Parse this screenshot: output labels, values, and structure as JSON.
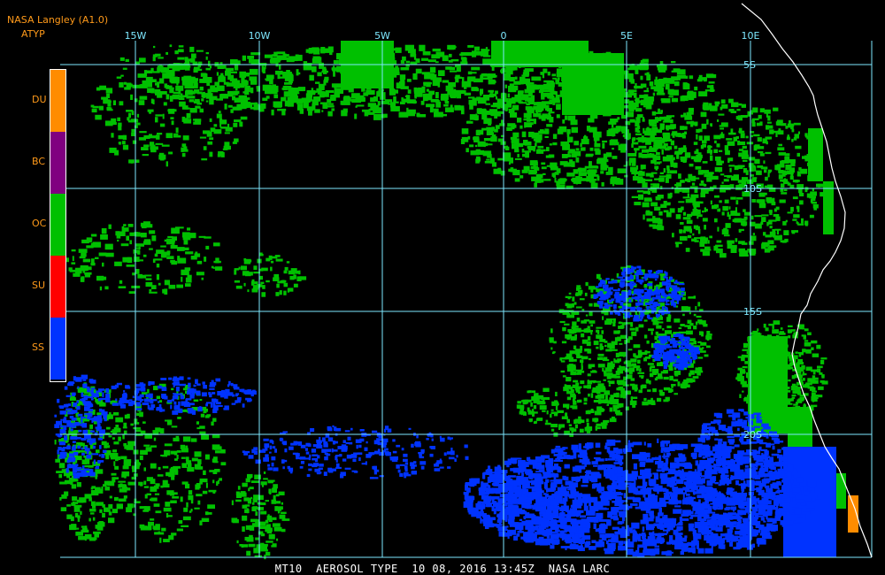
{
  "header": {
    "title": "NASA Langley (A1.0)",
    "product": "ATYP"
  },
  "legend": [
    {
      "code": "DU",
      "color": "#ff8c00"
    },
    {
      "code": "BC",
      "color": "#800080"
    },
    {
      "code": "OC",
      "color": "#00c000"
    },
    {
      "code": "SU",
      "color": "#ff0000"
    },
    {
      "code": "SS",
      "color": "#0033ff"
    }
  ],
  "grid": {
    "longitude_labels": [
      "15W",
      "10W",
      "5W",
      "0",
      "5E",
      "10E"
    ],
    "latitude_labels": [
      "5S",
      "10S",
      "15S",
      "20S"
    ],
    "line_color": "#7ee8ff"
  },
  "coastline_color": "#ffffff",
  "footer": {
    "text": "MT10  AEROSOL TYPE  10 08, 2016 13:45Z  NASA LARC"
  }
}
